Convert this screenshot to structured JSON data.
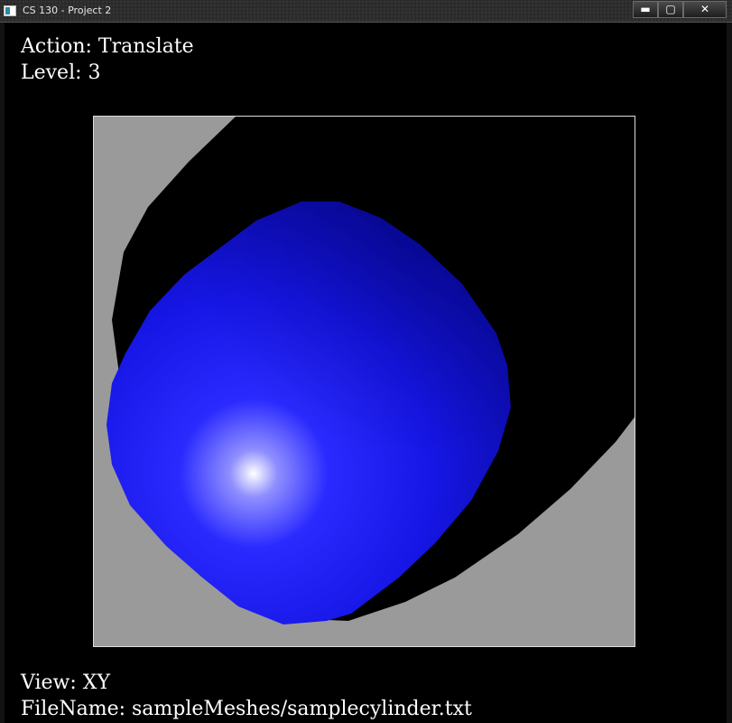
{
  "window": {
    "title": "CS 130 - Project 2",
    "controls": {
      "minimize": "▬",
      "maximize": "▢",
      "close": "✕"
    }
  },
  "hud": {
    "action": "Action: Translate",
    "level": "Level: 3",
    "view": "View: XY",
    "filename": "FileName: sampleMeshes/samplecylinder.txt"
  },
  "scene": {
    "background_color": "#9a9a9a",
    "shadow_color": "#000000",
    "mesh_color": "#1a1aff",
    "highlight_color": "#ffffff"
  }
}
